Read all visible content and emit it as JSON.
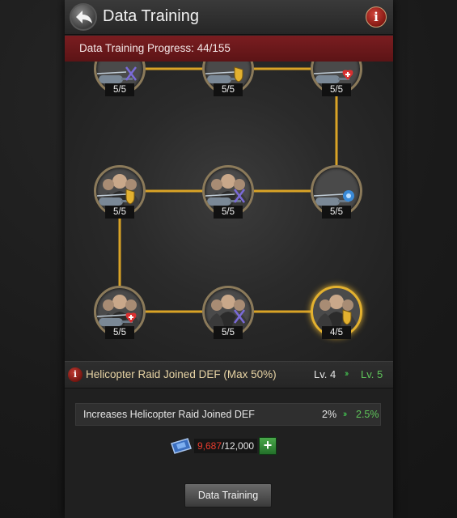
{
  "header": {
    "title": "Data Training",
    "back_icon": "back-arrow-icon",
    "info_icon": "info-icon"
  },
  "progress": {
    "text": "Data Training Progress: 44/155",
    "done": 44,
    "total": 155
  },
  "nodes": [
    {
      "count": "5/5",
      "badge": "crossed-swords-icon",
      "badge_color": "#7a6ad8",
      "kind": "helicopter"
    },
    {
      "count": "5/5",
      "badge": "shield-icon",
      "badge_color": "#e3b12f",
      "kind": "helicopter"
    },
    {
      "count": "5/5",
      "badge": "health-plus-icon",
      "badge_color": "#d93030",
      "kind": "helicopter"
    },
    {
      "count": "5/5",
      "badge": "shield-icon",
      "badge_color": "#e3b12f",
      "kind": "soldier-helicopter"
    },
    {
      "count": "5/5",
      "badge": "crossed-swords-icon",
      "badge_color": "#7a6ad8",
      "kind": "soldier-helicopter"
    },
    {
      "count": "5/5",
      "badge": "blue-orb-icon",
      "badge_color": "#3a8ad8",
      "kind": "helicopter"
    },
    {
      "count": "5/5",
      "badge": "health-plus-icon",
      "badge_color": "#d93030",
      "kind": "soldier-helicopter"
    },
    {
      "count": "5/5",
      "badge": "crossed-swords-icon",
      "badge_color": "#7a6ad8",
      "kind": "soldiers"
    },
    {
      "count": "4/5",
      "badge": "shield-icon",
      "badge_color": "#e3b12f",
      "kind": "soldiers",
      "active": true
    }
  ],
  "skill": {
    "name": "Helicopter Raid Joined DEF (Max 50%)",
    "level_current": "Lv. 4",
    "level_next": "Lv. 5"
  },
  "effect": {
    "description": "Increases Helicopter Raid Joined DEF",
    "value_current": "2%",
    "value_next": "2.5%"
  },
  "resource": {
    "have": "9,687",
    "total": "/12,000",
    "icon": "data-chip-icon"
  },
  "buttons": {
    "train": "Data Training",
    "add": "+"
  },
  "colors": {
    "accent_gold": "#e3b12f",
    "progress_bg": "#6b181b",
    "green": "#5fc55a",
    "red": "#e63b2e"
  }
}
